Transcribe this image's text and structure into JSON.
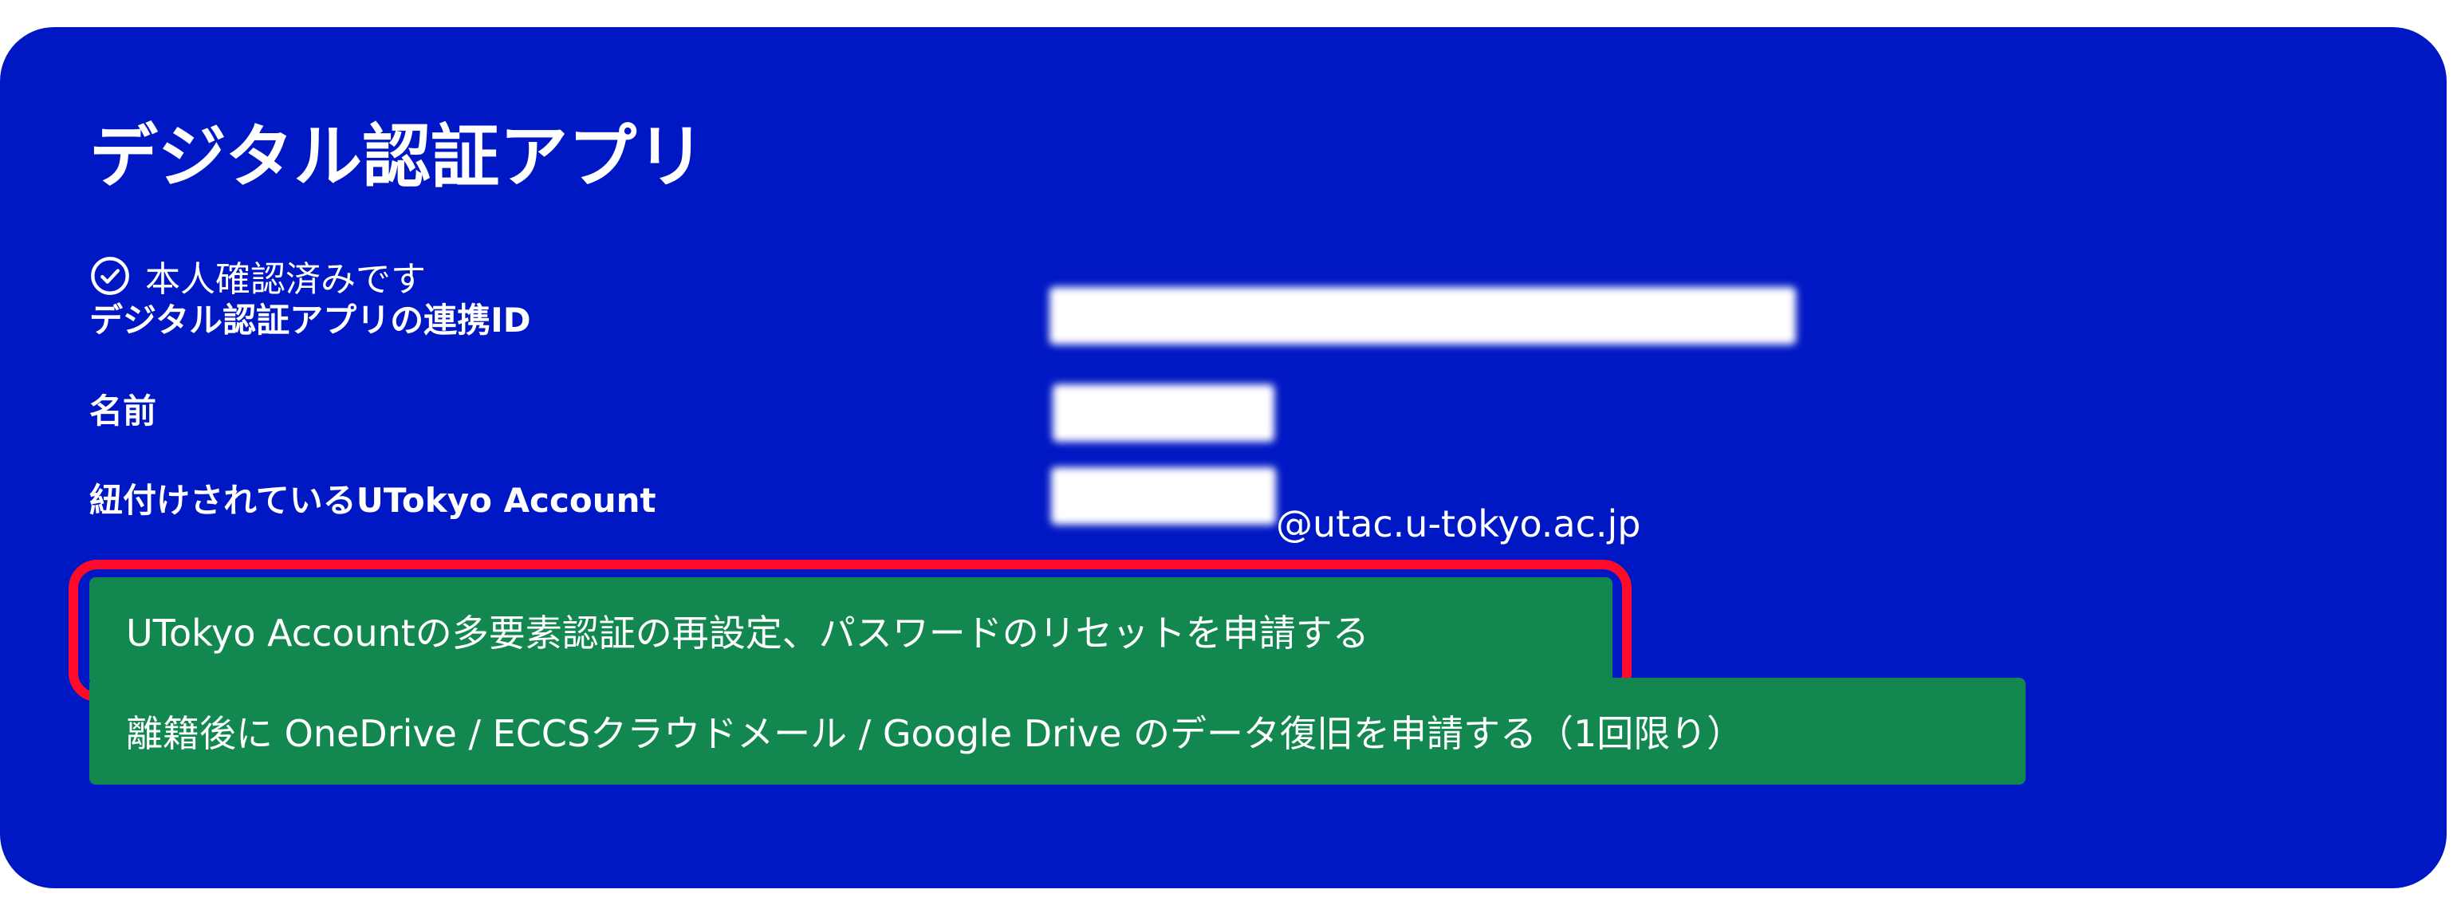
{
  "card": {
    "title": "デジタル認証アプリ",
    "verified_text": "本人確認済みです",
    "rows": [
      {
        "label": "デジタル認証アプリの連携ID"
      },
      {
        "label": "名前"
      },
      {
        "label": "紐付けされているUTokyo Account",
        "email_domain": "@utac.u-tokyo.ac.jp"
      }
    ],
    "buttons": {
      "reset": "UTokyo Accountの多要素認証の再設定、パスワードのリセットを申請する",
      "recovery": "離籍後に OneDrive / ECCSクラウドメール / Google Drive のデータ復旧を申請する（1回限り）"
    }
  },
  "colors": {
    "card_background": "#0018c4",
    "button_background": "#138750",
    "highlight_border": "#ff0a2a",
    "text": "#ffffff"
  },
  "icons": {
    "verified": "check-circle-icon"
  }
}
